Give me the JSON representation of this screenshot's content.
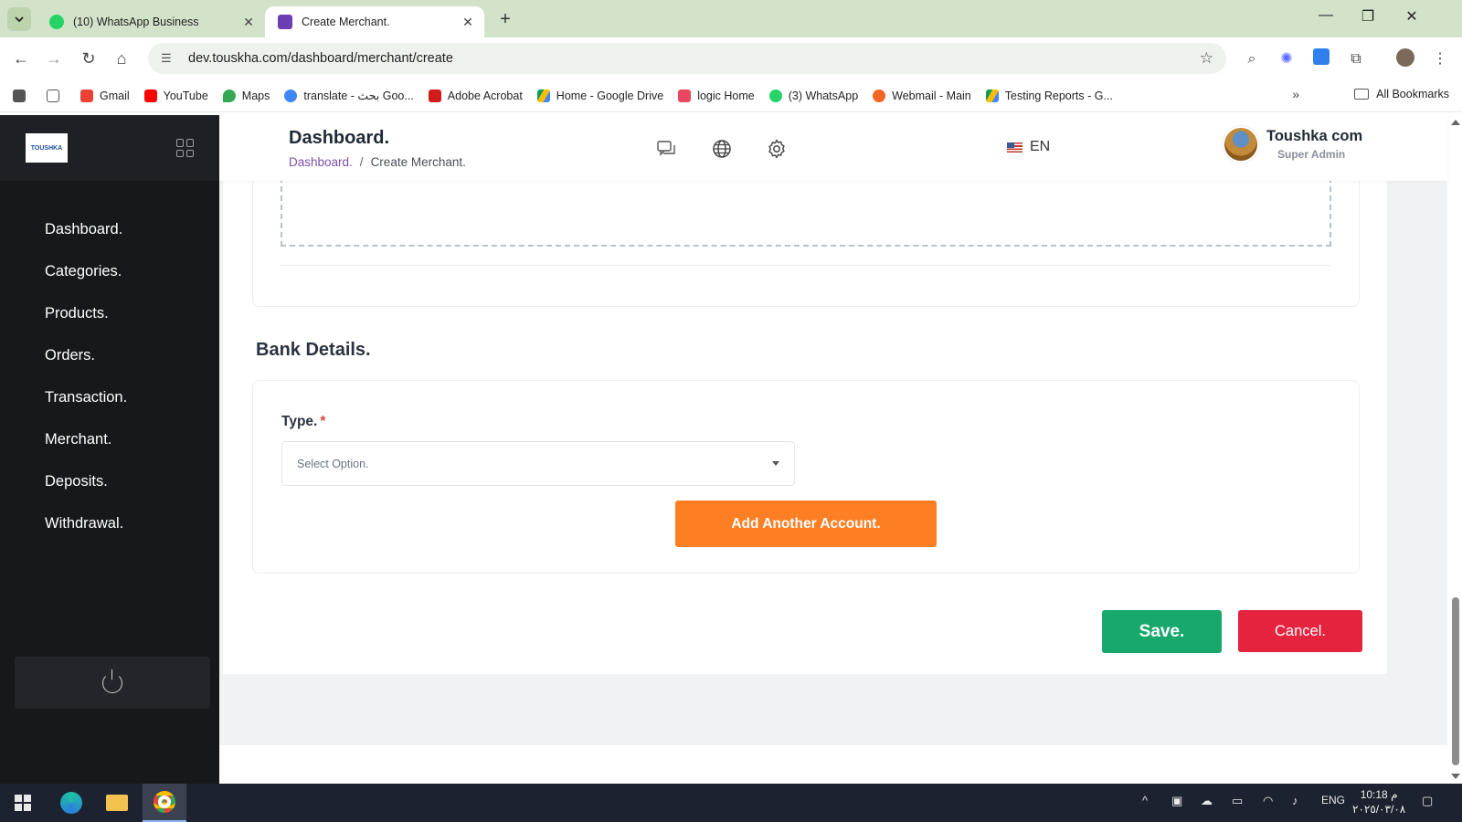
{
  "browser": {
    "tabs": [
      {
        "title": "(10) WhatsApp Business",
        "active": false
      },
      {
        "title": "Create Merchant.",
        "active": true
      }
    ],
    "url": "dev.touskha.com/dashboard/merchant/create",
    "bookmarks": [
      {
        "label": "Gmail",
        "color": "#ea4335"
      },
      {
        "label": "YouTube",
        "color": "#ff0000"
      },
      {
        "label": "Maps",
        "color": "#34a853"
      },
      {
        "label": "translate - بحث Goo...",
        "color": "#4285f4"
      },
      {
        "label": "Adobe Acrobat",
        "color": "#d21b1b"
      },
      {
        "label": "Home - Google Drive",
        "color": "#fbbc04"
      },
      {
        "label": "logic Home",
        "color": "#e9465f"
      },
      {
        "label": "(3) WhatsApp",
        "color": "#25d366"
      },
      {
        "label": "Webmail - Main",
        "color": "#f26522"
      },
      {
        "label": "Testing Reports - G...",
        "color": "#0f9d58"
      }
    ],
    "all_bookmarks": "All Bookmarks"
  },
  "sidebar": {
    "logo_text": "TOUSHKA",
    "items": [
      {
        "label": "Dashboard."
      },
      {
        "label": "Categories."
      },
      {
        "label": "Products."
      },
      {
        "label": "Orders."
      },
      {
        "label": "Transaction."
      },
      {
        "label": "Merchant."
      },
      {
        "label": "Deposits."
      },
      {
        "label": "Withdrawal."
      }
    ]
  },
  "header": {
    "title": "Dashboard.",
    "breadcrumb_root": "Dashboard.",
    "breadcrumb_sep": "/",
    "breadcrumb_current": "Create Merchant.",
    "language": "EN",
    "user_name": "Toushka com",
    "user_role": "Super Admin"
  },
  "form": {
    "bank_section_title": "Bank Details.",
    "type_label": "Type.",
    "required_mark": "*",
    "type_placeholder": "Select Option.",
    "add_account_label": "Add Another Account.",
    "save_label": "Save.",
    "cancel_label": "Cancel."
  },
  "taskbar": {
    "language": "ENG",
    "time": "10:18 م",
    "date": "٢٠٢٥/٠٣/٠٨"
  },
  "colors": {
    "accent_orange": "#fd7e23",
    "save_green": "#16a96b",
    "cancel_red": "#e4233f",
    "breadcrumb_link": "#7b4fa8",
    "sidebar_bg": "#17181c"
  }
}
